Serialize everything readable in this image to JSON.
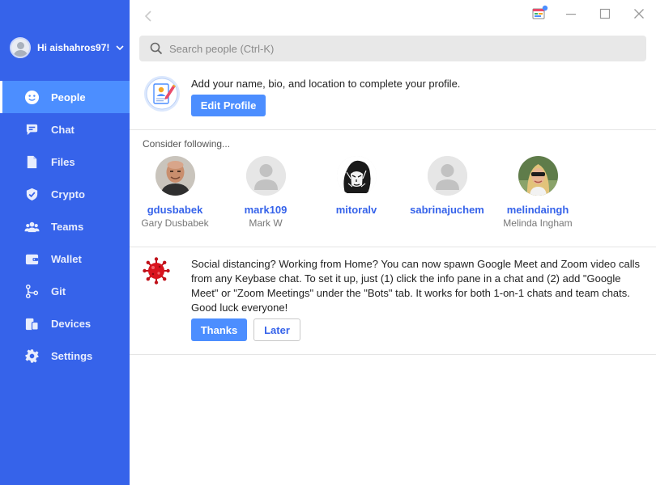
{
  "user": {
    "greeting": "Hi aishahros97!"
  },
  "nav": {
    "items": [
      {
        "label": "People",
        "icon": "smiley-icon",
        "active": true
      },
      {
        "label": "Chat",
        "icon": "chat-icon"
      },
      {
        "label": "Files",
        "icon": "file-icon"
      },
      {
        "label": "Crypto",
        "icon": "shield-icon"
      },
      {
        "label": "Teams",
        "icon": "team-icon"
      },
      {
        "label": "Wallet",
        "icon": "wallet-icon"
      },
      {
        "label": "Git",
        "icon": "git-icon"
      },
      {
        "label": "Devices",
        "icon": "devices-icon"
      },
      {
        "label": "Settings",
        "icon": "gear-icon"
      }
    ]
  },
  "search": {
    "placeholder": "Search people (Ctrl-K)"
  },
  "profile_prompt": {
    "text": "Add your name, bio, and location to complete your profile.",
    "button": "Edit Profile"
  },
  "follow": {
    "title": "Consider following...",
    "people": [
      {
        "username": "gdusbabek",
        "full_name": "Gary Dusbabek",
        "avatar": "photo"
      },
      {
        "username": "mark109",
        "full_name": "Mark W",
        "avatar": "placeholder"
      },
      {
        "username": "mitoralv",
        "full_name": "",
        "avatar": "sketch"
      },
      {
        "username": "sabrinajuchem",
        "full_name": "",
        "avatar": "placeholder"
      },
      {
        "username": "melindaingh",
        "full_name": "Melinda Ingham",
        "avatar": "photo"
      }
    ]
  },
  "notice": {
    "text": "Social distancing? Working from Home? You can now spawn Google Meet and Zoom video calls from any Keybase chat. To set it up, just (1) click the info pane in a chat and (2) add \"Google Meet\" or \"Zoom Meetings\" under the \"Bots\" tab. It works for both 1-on-1 chats and team chats. Good luck everyone!",
    "thanks_label": "Thanks",
    "later_label": "Later"
  },
  "colors": {
    "sidebar": "#3663ea",
    "active_nav": "#4c8eff",
    "accent": "#3663ea",
    "button": "#4c8eff"
  }
}
